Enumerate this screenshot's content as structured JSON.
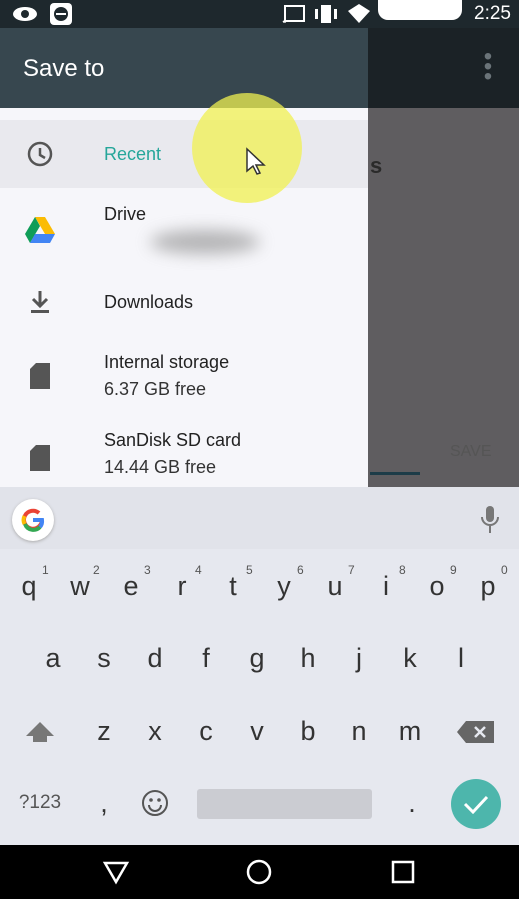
{
  "status_bar": {
    "time": "2:25"
  },
  "toolbar": {
    "title": "Save to",
    "more_icon": "more-vert-icon"
  },
  "drawer": {
    "items": [
      {
        "label": "Recent",
        "icon": "clock-icon",
        "selected": true
      },
      {
        "label": "Drive",
        "icon": "google-drive-icon"
      },
      {
        "label": "Downloads",
        "icon": "download-icon"
      },
      {
        "label": "Internal storage",
        "subtitle": "6.37 GB free",
        "icon": "sd-card-icon"
      },
      {
        "label": "SanDisk SD card",
        "subtitle": "14.44 GB free",
        "icon": "sd-card-icon"
      }
    ]
  },
  "background": {
    "partial_text": "s",
    "save_label": "SAVE"
  },
  "keyboard": {
    "row1": [
      "q",
      "w",
      "e",
      "r",
      "t",
      "y",
      "u",
      "i",
      "o",
      "p"
    ],
    "row1_nums": [
      "1",
      "2",
      "3",
      "4",
      "5",
      "6",
      "7",
      "8",
      "9",
      "0"
    ],
    "row2": [
      "a",
      "s",
      "d",
      "f",
      "g",
      "h",
      "j",
      "k",
      "l"
    ],
    "row3": [
      "z",
      "x",
      "c",
      "v",
      "b",
      "n",
      "m"
    ],
    "symbols_key": "?123",
    "comma": ",",
    "period": "."
  },
  "colors": {
    "accent": "#26a69a",
    "toolbar": "#37474f",
    "highlight": "#f1f25a"
  }
}
